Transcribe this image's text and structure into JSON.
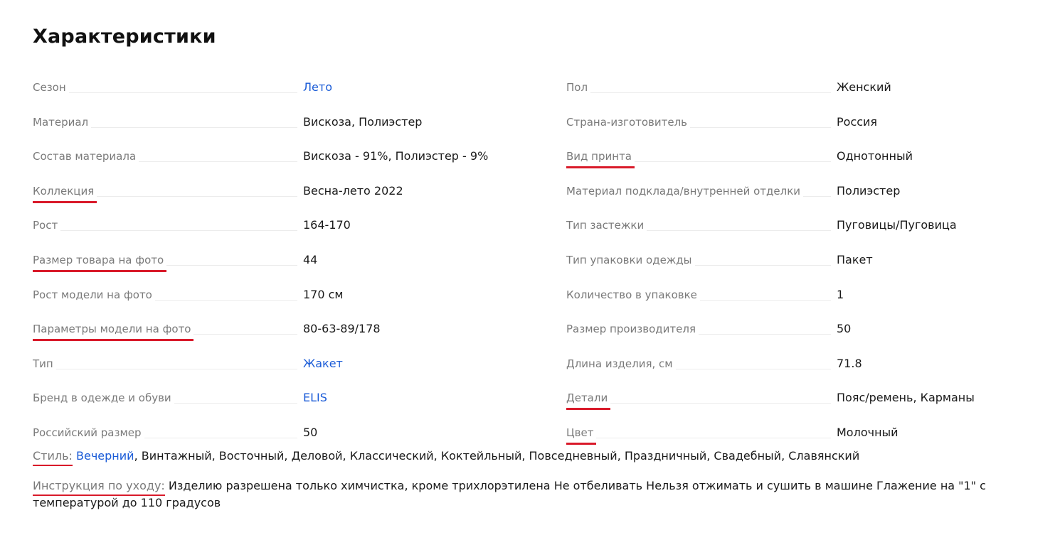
{
  "title": "Характеристики",
  "left": [
    {
      "label": "Сезон",
      "value": "Лето",
      "link": true,
      "marked": false
    },
    {
      "label": "Материал",
      "value": "Вискоза, Полиэстер",
      "link": false,
      "marked": false
    },
    {
      "label": "Состав материала",
      "value": "Вискоза - 91%, Полиэстер - 9%",
      "link": false,
      "marked": false
    },
    {
      "label": "Коллекция",
      "value": "Весна-лето 2022",
      "link": false,
      "marked": true
    },
    {
      "label": "Рост",
      "value": "164-170",
      "link": false,
      "marked": false
    },
    {
      "label": "Размер товара на фото",
      "value": "44",
      "link": false,
      "marked": true
    },
    {
      "label": "Рост модели на фото",
      "value": "170 см",
      "link": false,
      "marked": false
    },
    {
      "label": "Параметры модели на фото",
      "value": "80-63-89/178",
      "link": false,
      "marked": true
    },
    {
      "label": "Тип",
      "value": "Жакет",
      "link": true,
      "marked": false
    },
    {
      "label": "Бренд в одежде и обуви",
      "value": "ELIS",
      "link": true,
      "marked": false
    },
    {
      "label": "Российский размер",
      "value": "50",
      "link": false,
      "marked": false
    }
  ],
  "right": [
    {
      "label": "Пол",
      "value": "Женский",
      "link": false,
      "marked": false
    },
    {
      "label": "Страна-изготовитель",
      "value": "Россия",
      "link": false,
      "marked": false
    },
    {
      "label": "Вид принта",
      "value": "Однотонный",
      "link": false,
      "marked": true
    },
    {
      "label": "Материал подклада/внутренней отделки",
      "value": "Полиэстер",
      "link": false,
      "marked": false
    },
    {
      "label": "Тип застежки",
      "value": "Пуговицы/Пуговица",
      "link": false,
      "marked": false
    },
    {
      "label": "Тип упаковки одежды",
      "value": "Пакет",
      "link": false,
      "marked": false
    },
    {
      "label": "Количество в упаковке",
      "value": "1",
      "link": false,
      "marked": false
    },
    {
      "label": "Размер производителя",
      "value": "50",
      "link": false,
      "marked": false
    },
    {
      "label": "Длина изделия, см",
      "value": "71.8",
      "link": false,
      "marked": false
    },
    {
      "label": "Детали",
      "value": "Пояс/ремень, Карманы",
      "link": false,
      "marked": true
    },
    {
      "label": "Цвет",
      "value": "Молочный",
      "link": false,
      "marked": true
    }
  ],
  "style": {
    "label": "Стиль:",
    "first": "Вечерний",
    "rest": ", Винтажный, Восточный, Деловой, Классический, Коктейльный, Повседневный, Праздничный, Свадебный, Славянский"
  },
  "care": {
    "label": "Инструкция по уходу:",
    "text": "Изделию разрешена только химчистка, кроме трихлорэтилена Не отбеливать Нельзя отжимать и сушить в машине Глажение на \"1\" с температурой до 110 градусов"
  },
  "colors": {
    "link": "#1a5bd7",
    "marker": "#d91a2a",
    "label": "#7a7a7a"
  }
}
